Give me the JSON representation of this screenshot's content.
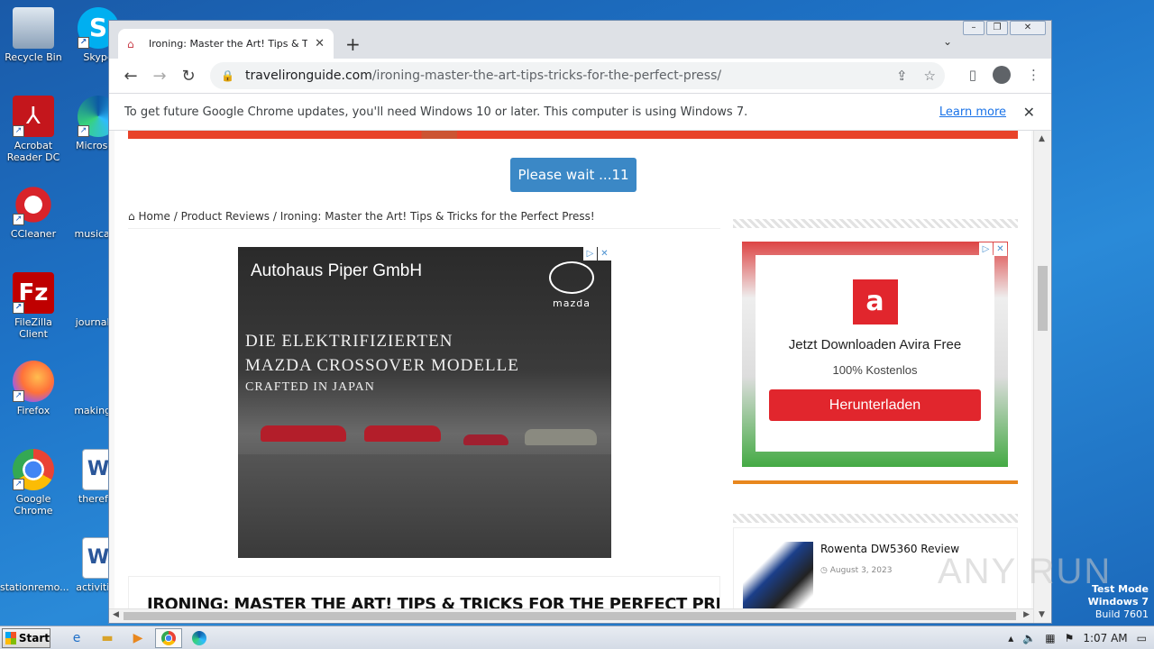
{
  "desktop": {
    "icons": [
      {
        "label": "Recycle Bin"
      },
      {
        "label": "Skype"
      },
      {
        "label": "Acrobat Reader DC"
      },
      {
        "label": "Microsoft"
      },
      {
        "label": "CCleaner"
      },
      {
        "label": "musicalfo"
      },
      {
        "label": "FileZilla Client"
      },
      {
        "label": "journalco"
      },
      {
        "label": "Firefox"
      },
      {
        "label": "makingac"
      },
      {
        "label": "Google Chrome"
      },
      {
        "label": "therefor"
      },
      {
        "label": "stationremo..."
      },
      {
        "label": "activities"
      }
    ]
  },
  "browser": {
    "tab_title": "Ironing: Master the Art! Tips & Tricks",
    "url_domain": "travelironguide.com",
    "url_path": "/ironing-master-the-art-tips-tricks-for-the-perfect-press/",
    "infobar_text": "To get future Google Chrome updates, you'll need Windows 10 or later. This computer is using Windows 7.",
    "infobar_link": "Learn more"
  },
  "page": {
    "wait_button": "Please wait ...11",
    "breadcrumb": {
      "home": "Home",
      "sep": " / ",
      "category": "Product Reviews",
      "current": "Ironing: Master the Art! Tips & Tricks for the Perfect Press!"
    },
    "ad_main": {
      "brand": "Autohaus Piper GmbH",
      "logo": "mazda",
      "line1": "DIE ELEKTRIFIZIERTEN",
      "line2": "MAZDA CROSSOVER MODELLE",
      "line3": "CRAFTED IN JAPAN"
    },
    "article_title": "IRONING: MASTER THE ART! TIPS & TRICKS FOR THE PERFECT PRESS!",
    "side_ad": {
      "headline": "Jetzt Downloaden Avira Free",
      "sub": "100% Kostenlos",
      "button": "Herunterladen"
    },
    "related": {
      "title": "Rowenta DW5360 Review",
      "date": "August 3, 2023"
    }
  },
  "watermark": {
    "text": "ANY RUN",
    "mode": "Test Mode",
    "os": "Windows 7",
    "build": "Build 7601"
  },
  "taskbar": {
    "start": "Start",
    "time": "1:07 AM"
  },
  "colors": {
    "accent_blue": "#3b88c6",
    "avira_red": "#e1262d",
    "sidebar_orange": "#e8871e"
  }
}
